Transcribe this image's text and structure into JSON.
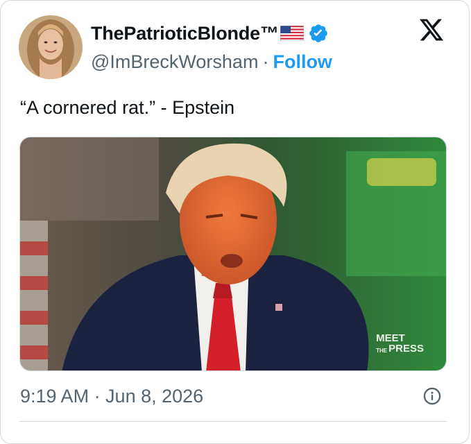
{
  "author": {
    "display_name": "ThePatrioticBlonde",
    "trademark": "™",
    "flag_icon": "us-flag-icon",
    "verified_icon": "verified-badge-icon",
    "handle": "@ImBreckWorsham",
    "separator": "·",
    "follow_label": "Follow"
  },
  "platform_logo": "x-logo-icon",
  "tweet": {
    "text": "“A cornered rat.” - Epstein",
    "timestamp": "9:19 AM · Jun 8, 2026"
  },
  "media": {
    "watermark_line1": "MEET",
    "watermark_line2": "PRESS",
    "watermark_small": "THE"
  },
  "colors": {
    "accent": "#1d9bf0",
    "text_primary": "#0f1419",
    "text_secondary": "#536471",
    "border": "#cfd9de"
  }
}
